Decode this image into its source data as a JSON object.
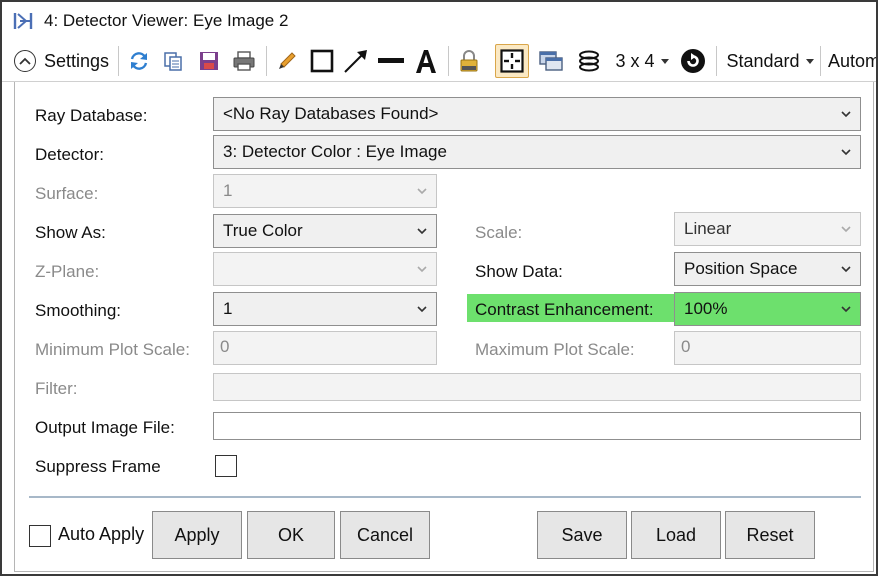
{
  "window": {
    "title": "4: Detector Viewer: Eye Image 2"
  },
  "toolbar": {
    "settings_label": "Settings",
    "layout_label": "3 x 4",
    "standard_label": "Standard",
    "auto_label": "Autom",
    "icons": [
      "settings-chevron-icon",
      "refresh-icon",
      "copy-icon",
      "save-icon",
      "print-icon",
      "pencil-icon",
      "rectangle-icon",
      "arrow-icon",
      "line-icon",
      "text-icon",
      "lock-icon",
      "grid-icon",
      "window-icon",
      "layers-icon",
      "rotate-icon"
    ]
  },
  "form": {
    "ray_database": {
      "label": "Ray Database:",
      "value": "<No Ray Databases Found>"
    },
    "detector": {
      "label": "Detector:",
      "value": "3: Detector Color : Eye Image"
    },
    "surface": {
      "label": "Surface:",
      "value": "1"
    },
    "show_as": {
      "label": "Show As:",
      "value": "True Color"
    },
    "scale": {
      "label": "Scale:",
      "value": "Linear"
    },
    "z_plane": {
      "label": "Z-Plane:",
      "value": ""
    },
    "show_data": {
      "label": "Show Data:",
      "value": "Position Space"
    },
    "smoothing": {
      "label": "Smoothing:",
      "value": "1"
    },
    "contrast": {
      "label": "Contrast Enhancement:",
      "value": "100%",
      "highlight_color": "#6de06d"
    },
    "min_plot_scale": {
      "label": "Minimum Plot Scale:",
      "value": "0"
    },
    "max_plot_scale": {
      "label": "Maximum Plot Scale:",
      "value": "0"
    },
    "filter": {
      "label": "Filter:",
      "value": ""
    },
    "output_image_file": {
      "label": "Output Image File:",
      "value": ""
    },
    "suppress_frame": {
      "label": "Suppress Frame",
      "checked": false
    }
  },
  "footer": {
    "auto_apply": {
      "label": "Auto Apply",
      "checked": false
    },
    "apply": "Apply",
    "ok": "OK",
    "cancel": "Cancel",
    "save": "Save",
    "load": "Load",
    "reset": "Reset"
  }
}
